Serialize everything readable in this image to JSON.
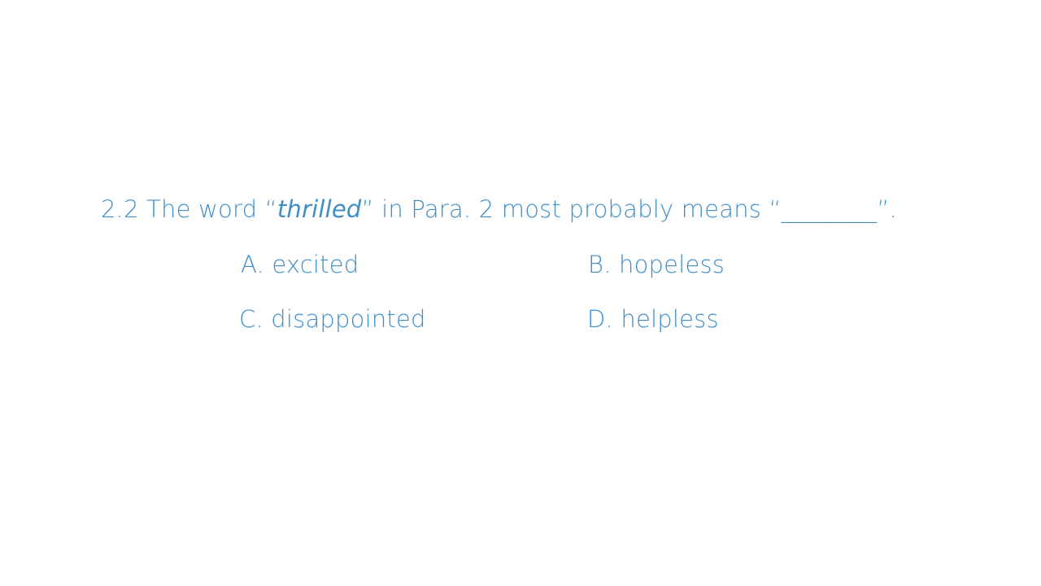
{
  "question": {
    "prefix": "2.2 The word “",
    "keyword": "thrilled",
    "suffix": "” in Para. 2 most probably means “________”."
  },
  "options": [
    {
      "text": "A. excited"
    },
    {
      "text": "B. hopeless"
    },
    {
      "text": "C. disappointed"
    },
    {
      "text": "D. helpless"
    }
  ],
  "colors": {
    "text": "#3d8ec9",
    "background": "#ffffff"
  }
}
